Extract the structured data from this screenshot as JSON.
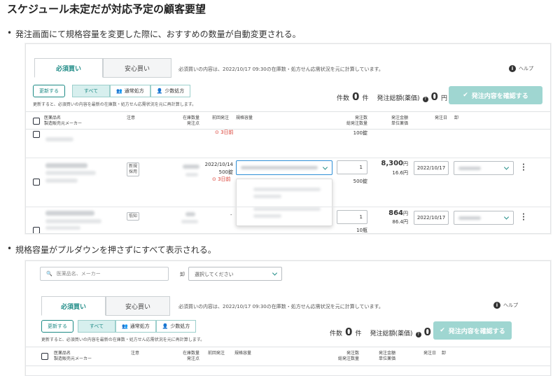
{
  "doc": {
    "title": "スケジュール未定だが対応予定の顧客要望",
    "bullet1": "発注画面にて規格容量を変更した際に、おすすめの数量が自動変更される。",
    "bullet2": "規格容量がプルダウンを押さずにすべて表示される。"
  },
  "screen": {
    "tabs": [
      "必須買い",
      "安心買い"
    ],
    "tab_note": "必須買いの内容は、2022/10/17 09:30の在庫数・処方せん応需状況を元に計算しています。",
    "help": "ヘルプ",
    "update_button": "更新する",
    "segments": [
      "すべて",
      "通常処方",
      "少数処方"
    ],
    "hint": "更新すると、必須買いの内容を最新の在庫数・処方せん応需状況を元に再計算します。",
    "count_label": "件数",
    "count_value": "0",
    "count_unit": "件",
    "total_label": "発注総額(薬価)",
    "total_value": "0",
    "total_unit": "円",
    "confirm_button": "発注内容を確認する",
    "headers": {
      "name_1": "医薬品名",
      "name_2": "製造販売元メーカー",
      "note": "注意",
      "stock_1": "在庫数量",
      "stock_2": "発注点",
      "prev": "前回発注",
      "spec": "規格容量",
      "qty_1": "発注数",
      "qty_2": "総発注数量",
      "amount_1": "発注金額",
      "amount_2": "単位薬価",
      "date": "発注日",
      "wholesaler": "卸"
    }
  },
  "shot1": {
    "row0": {
      "unit_total": "100錠",
      "warn": "3日前"
    },
    "row1": {
      "tag": "新規採用",
      "prev_date": "2022/10/14",
      "prev_qty": "500錠",
      "warn": "3日前",
      "qty": "1",
      "unit_total": "500錠",
      "amount": "8,300",
      "amount_unit": "円",
      "unit_price": "16.6円",
      "date": "2022/10/17"
    },
    "row2": {
      "tag": "低知",
      "prev": "-",
      "qty": "1",
      "unit_total": "10瓶",
      "amount": "864",
      "amount_unit": "円",
      "unit_price": "86.4円",
      "date": "2022/10/17"
    }
  },
  "shot2": {
    "search_placeholder": "医薬品名、メーカー",
    "wholesaler_label": "卸",
    "wholesaler_placeholder": "選択してください"
  }
}
